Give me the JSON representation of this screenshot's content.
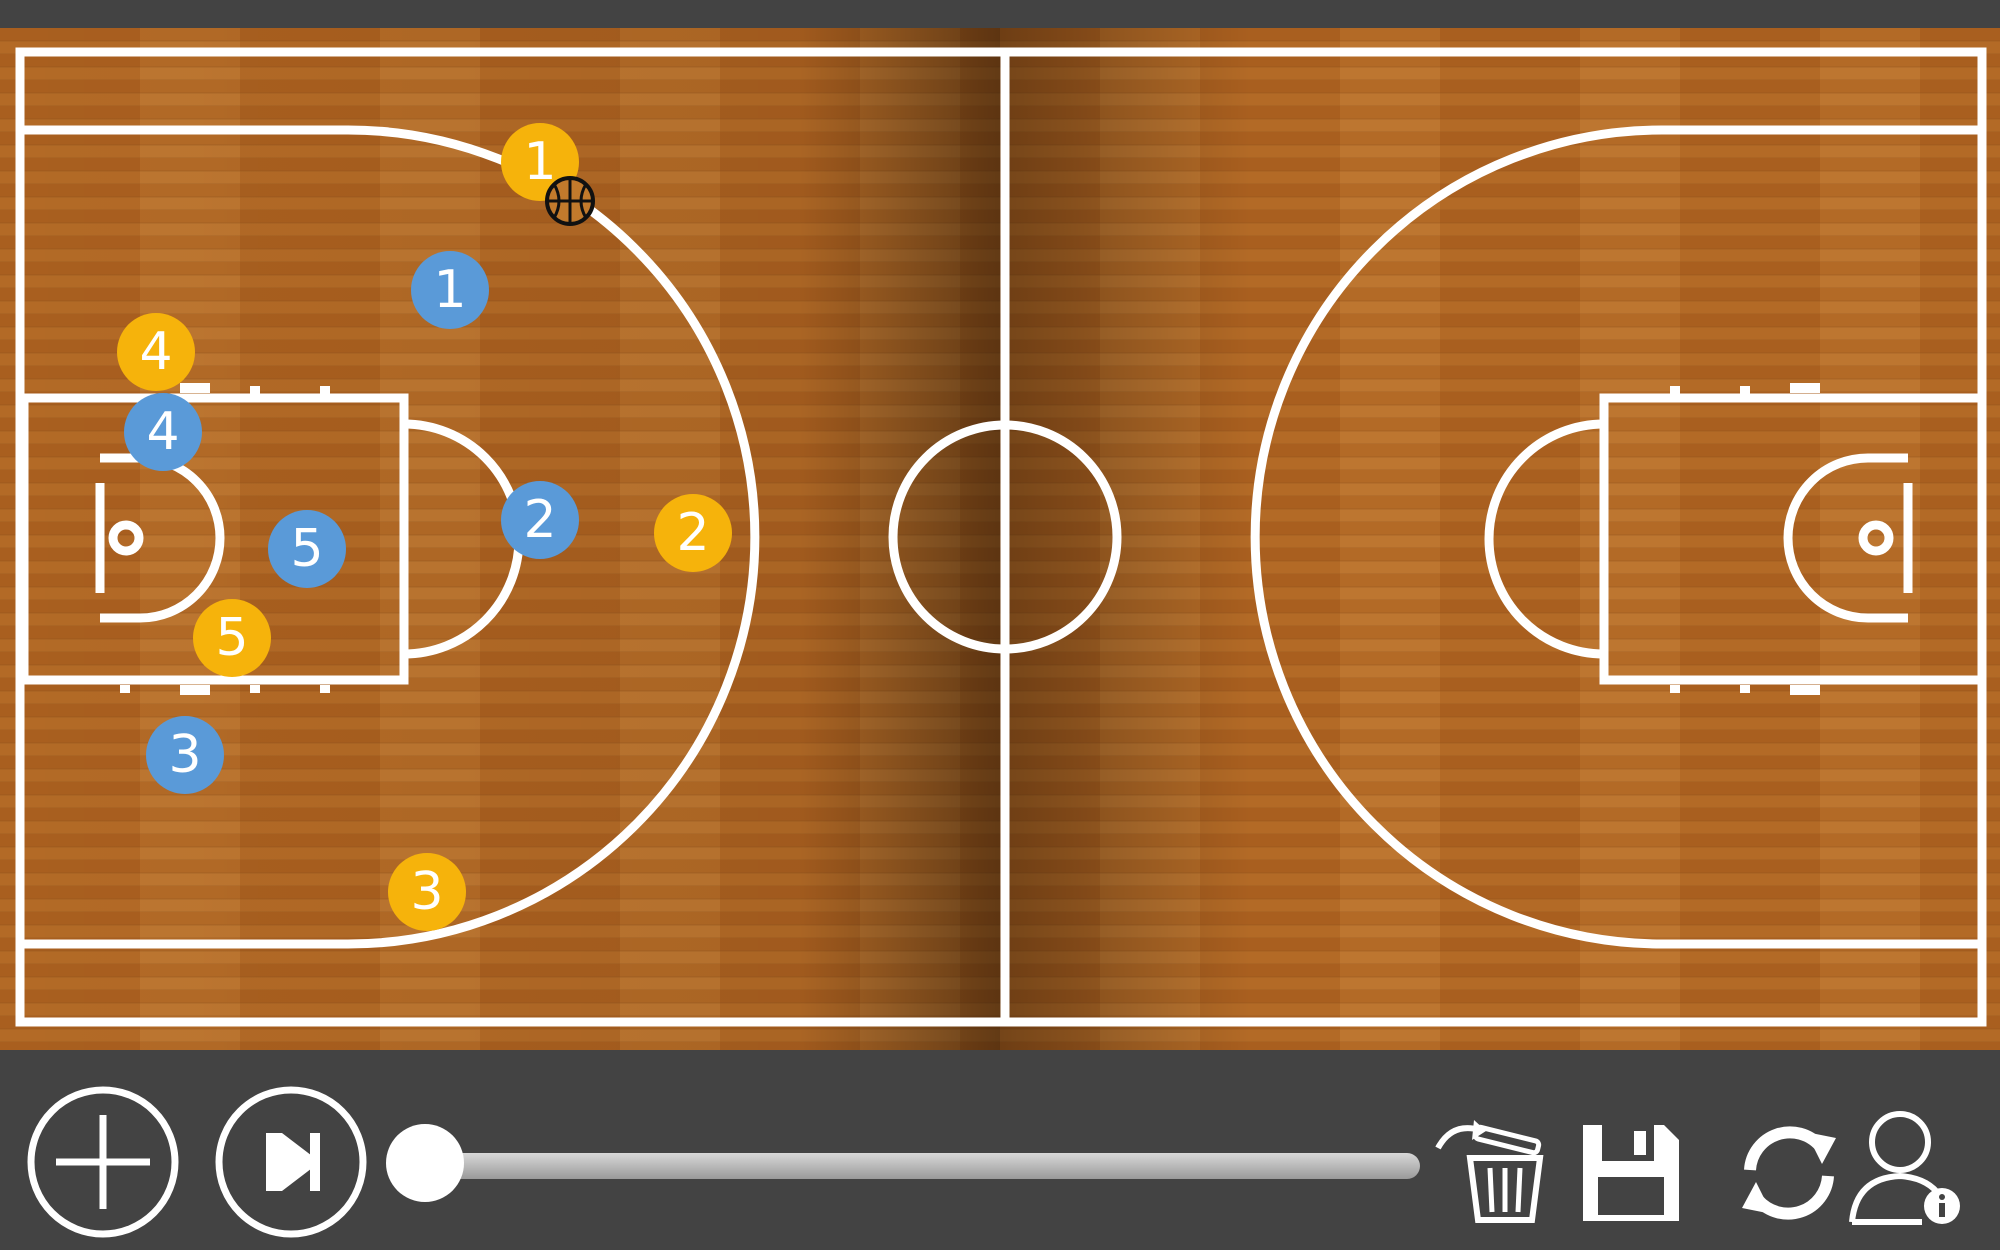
{
  "colors": {
    "offense": "#f6b30b",
    "defense": "#5a9ad8",
    "court_lines": "#ffffff",
    "floor": "#b36a26",
    "toolbar_bg": "#434343"
  },
  "players": {
    "offense": [
      {
        "number": "1"
      },
      {
        "number": "2"
      },
      {
        "number": "3"
      },
      {
        "number": "4"
      },
      {
        "number": "5"
      }
    ],
    "defense": [
      {
        "number": "1"
      },
      {
        "number": "2"
      },
      {
        "number": "3"
      },
      {
        "number": "4"
      },
      {
        "number": "5"
      }
    ]
  },
  "ball": {
    "icon": "basketball-icon",
    "holder": "offense player 1"
  },
  "toolbar": {
    "add_icon": "plus-circle-icon",
    "play_icon": "play-next-frame-icon",
    "timeline_progress": 0,
    "delete_icon": "trash-icon",
    "save_icon": "floppy-disk-icon",
    "refresh_icon": "refresh-arrows-icon",
    "user_info_icon": "user-info-icon"
  }
}
